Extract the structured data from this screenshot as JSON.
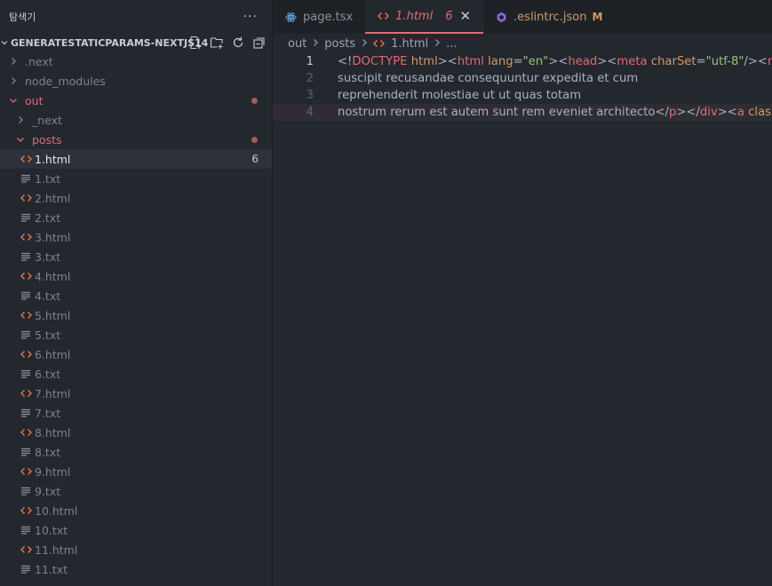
{
  "sidebar": {
    "title": "탐색기",
    "more": "···",
    "project": "GENERATESTATICPARAMS-NEXTJS14",
    "tree": [
      {
        "label": ".next",
        "kind": "folder",
        "open": false,
        "depth": 0,
        "color": "dim"
      },
      {
        "label": "node_modules",
        "kind": "folder",
        "open": false,
        "depth": 0,
        "color": "dim"
      },
      {
        "label": "out",
        "kind": "folder",
        "open": true,
        "depth": 0,
        "color": "red",
        "dot": true
      },
      {
        "label": "_next",
        "kind": "folder",
        "open": false,
        "depth": 1,
        "color": "dim"
      },
      {
        "label": "posts",
        "kind": "folder",
        "open": true,
        "depth": 1,
        "color": "red",
        "dot": true
      },
      {
        "label": "1.html",
        "kind": "html",
        "depth": 2,
        "color": "active",
        "badge": "6"
      },
      {
        "label": "1.txt",
        "kind": "txt",
        "depth": 2
      },
      {
        "label": "2.html",
        "kind": "html",
        "depth": 2
      },
      {
        "label": "2.txt",
        "kind": "txt",
        "depth": 2
      },
      {
        "label": "3.html",
        "kind": "html",
        "depth": 2
      },
      {
        "label": "3.txt",
        "kind": "txt",
        "depth": 2
      },
      {
        "label": "4.html",
        "kind": "html",
        "depth": 2
      },
      {
        "label": "4.txt",
        "kind": "txt",
        "depth": 2
      },
      {
        "label": "5.html",
        "kind": "html",
        "depth": 2
      },
      {
        "label": "5.txt",
        "kind": "txt",
        "depth": 2
      },
      {
        "label": "6.html",
        "kind": "html",
        "depth": 2
      },
      {
        "label": "6.txt",
        "kind": "txt",
        "depth": 2
      },
      {
        "label": "7.html",
        "kind": "html",
        "depth": 2
      },
      {
        "label": "7.txt",
        "kind": "txt",
        "depth": 2
      },
      {
        "label": "8.html",
        "kind": "html",
        "depth": 2
      },
      {
        "label": "8.txt",
        "kind": "txt",
        "depth": 2
      },
      {
        "label": "9.html",
        "kind": "html",
        "depth": 2
      },
      {
        "label": "9.txt",
        "kind": "txt",
        "depth": 2
      },
      {
        "label": "10.html",
        "kind": "html",
        "depth": 2
      },
      {
        "label": "10.txt",
        "kind": "txt",
        "depth": 2
      },
      {
        "label": "11.html",
        "kind": "html",
        "depth": 2
      },
      {
        "label": "11.txt",
        "kind": "txt",
        "depth": 2
      }
    ]
  },
  "tabs": [
    {
      "label": "page.tsx",
      "icon": "react-icon",
      "active": false
    },
    {
      "label": "1.html",
      "icon": "html-icon",
      "active": true,
      "count": "6",
      "close": "✕"
    },
    {
      "label": ".eslintrc.json",
      "icon": "eslint-icon",
      "active": false,
      "modified": "M"
    }
  ],
  "breadcrumb": [
    "out",
    "posts",
    "1.html",
    "..."
  ],
  "editor": {
    "lines": [
      {
        "n": "1",
        "current": true,
        "tokens": [
          {
            "t": "<!",
            "c": "c-gray"
          },
          {
            "t": "DOCTYPE",
            "c": "c-red"
          },
          {
            "t": " ",
            "c": "c-gray"
          },
          {
            "t": "html",
            "c": "c-orange"
          },
          {
            "t": "><",
            "c": "c-gray"
          },
          {
            "t": "html",
            "c": "c-red"
          },
          {
            "t": " ",
            "c": "c-gray"
          },
          {
            "t": "lang",
            "c": "c-orange"
          },
          {
            "t": "=",
            "c": "c-gray"
          },
          {
            "t": "\"en\"",
            "c": "c-green"
          },
          {
            "t": "><",
            "c": "c-gray"
          },
          {
            "t": "head",
            "c": "c-red"
          },
          {
            "t": "><",
            "c": "c-gray"
          },
          {
            "t": "meta",
            "c": "c-red"
          },
          {
            "t": " ",
            "c": "c-gray"
          },
          {
            "t": "charSet",
            "c": "c-orange"
          },
          {
            "t": "=",
            "c": "c-gray"
          },
          {
            "t": "\"utf-8\"",
            "c": "c-green"
          },
          {
            "t": "/><",
            "c": "c-gray"
          },
          {
            "t": "meta",
            "c": "c-red"
          }
        ]
      },
      {
        "n": "2",
        "tokens": [
          {
            "t": "suscipit recusandae consequuntur expedita et cum",
            "c": "c-gray"
          }
        ]
      },
      {
        "n": "3",
        "tokens": [
          {
            "t": "reprehenderit molestiae ut ut quas totam",
            "c": "c-gray"
          }
        ]
      },
      {
        "n": "4",
        "highlight": true,
        "tokens": [
          {
            "t": "nostrum rerum est autem sunt rem eveniet architecto</",
            "c": "c-gray"
          },
          {
            "t": "p",
            "c": "c-red"
          },
          {
            "t": "></",
            "c": "c-gray"
          },
          {
            "t": "div",
            "c": "c-red"
          },
          {
            "t": "><",
            "c": "c-gray"
          },
          {
            "t": "a",
            "c": "c-red"
          },
          {
            "t": " ",
            "c": "c-gray"
          },
          {
            "t": "class",
            "c": "c-orange"
          },
          {
            "t": "=",
            "c": "c-gray"
          }
        ]
      }
    ]
  },
  "colors": {
    "accent": "#e06c75",
    "modified": "#d19a66",
    "badge_dot": "#a45d57",
    "bg": "#23272e"
  }
}
